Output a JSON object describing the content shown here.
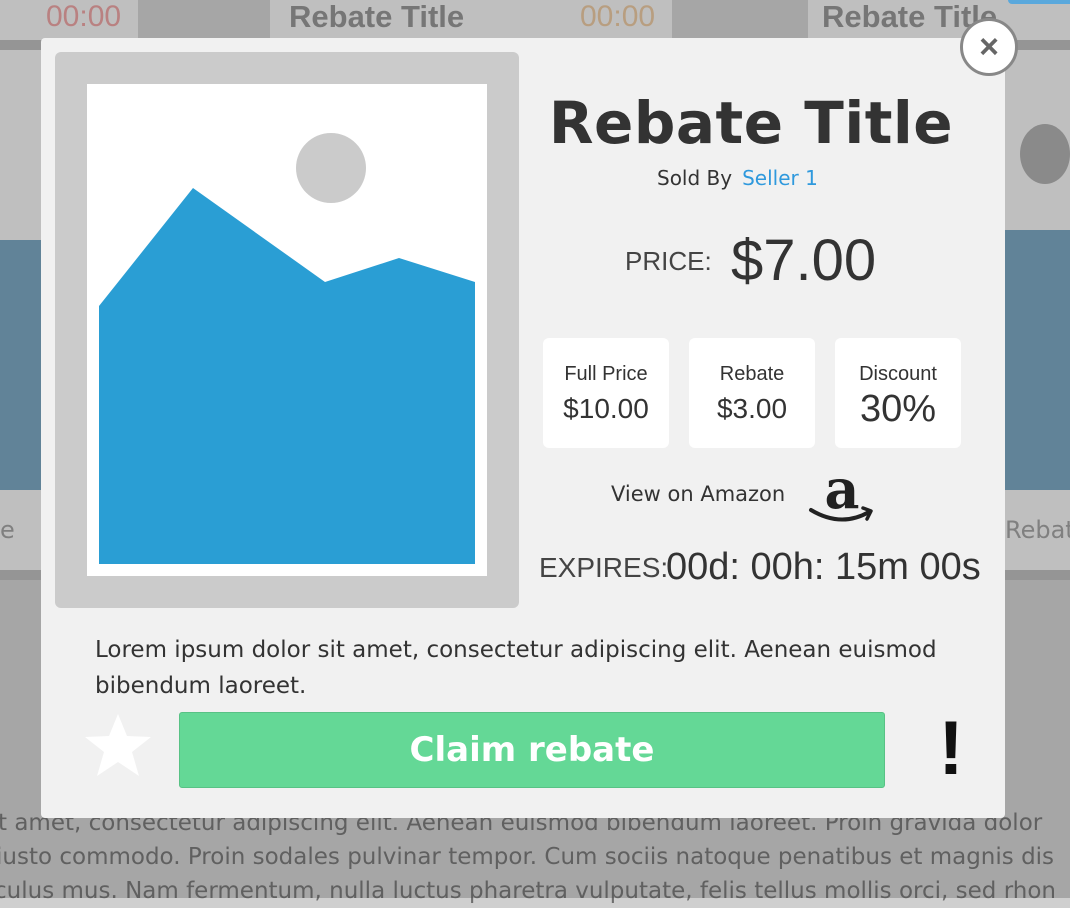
{
  "background": {
    "cards": [
      {
        "timer": "00:00",
        "title": "Rebate Title"
      },
      {
        "timer": "00:00",
        "title": "Rebate Title"
      }
    ],
    "side_labels": {
      "left": "e",
      "right": "Rebat"
    },
    "lorem_lines": [
      "t amet, consectetur adipiscing elit. Aenean euismod bibendum laoreet. Proin gravida dolor",
      "iusto commodo. Proin sodales pulvinar tempor. Cum sociis natoque penatibus et magnis dis",
      "culus mus. Nam fermentum, nulla luctus pharetra vulputate, felis tellus mollis orci, sed rhon"
    ]
  },
  "modal": {
    "close_label": "×",
    "title": "Rebate Title",
    "sold_by_label": "Sold By",
    "seller": "Seller 1",
    "price_label": "PRICE:",
    "price": "$7.00",
    "stats": [
      {
        "label": "Full Price",
        "value": "$10.00"
      },
      {
        "label": "Rebate",
        "value": "$3.00"
      },
      {
        "label": "Discount",
        "value": "30%"
      }
    ],
    "amazon_label": "View on Amazon",
    "amazon_icon": "amazon-logo-icon",
    "expires_label": "EXPIRES:",
    "expires_value": "00d: 00h: 15m 00s",
    "description": "Lorem ipsum dolor sit amet, consectetur adipiscing elit. Aenean euismod bibendum laoreet.",
    "claim_button": "Claim rebate",
    "favorite_icon": "star-icon",
    "report_label": "!"
  },
  "colors": {
    "accent_blue": "#2f99dd",
    "claim_green": "#64d896",
    "image_blue": "#2a9ed4"
  }
}
